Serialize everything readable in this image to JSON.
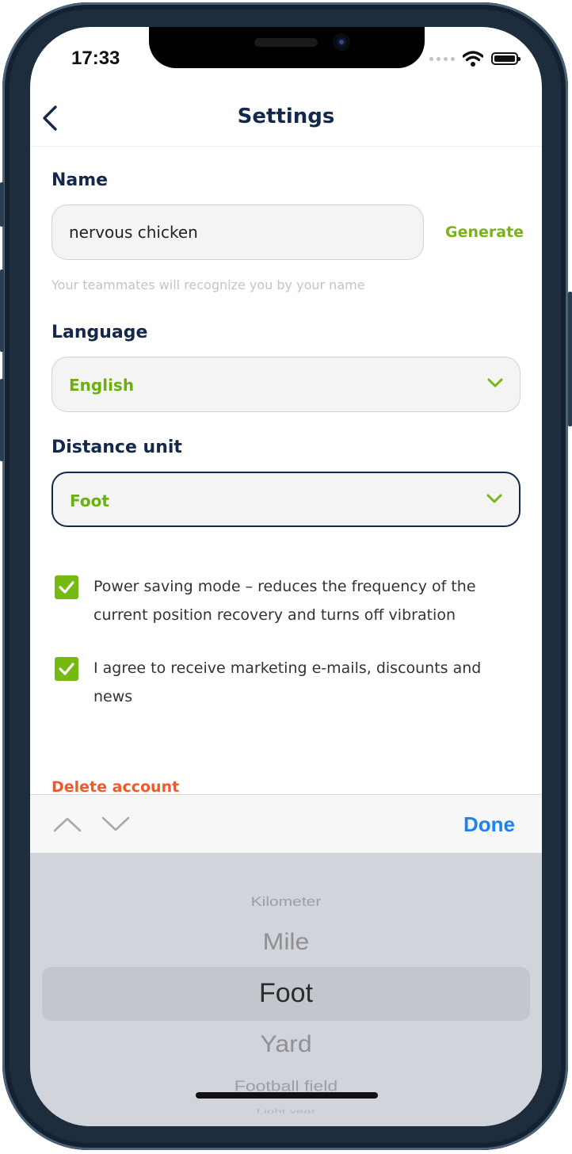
{
  "status_bar": {
    "time": "17:33"
  },
  "nav": {
    "title": "Settings"
  },
  "name_section": {
    "label": "Name",
    "value": "nervous chicken",
    "generate_label": "Generate",
    "hint": "Your teammates will recognize you by your name"
  },
  "language_section": {
    "label": "Language",
    "selected": "English"
  },
  "distance_section": {
    "label": "Distance unit",
    "selected": "Foot"
  },
  "checkboxes": [
    {
      "label": "Power saving mode – reduces the frequency of the current position recovery and turns off vibration",
      "checked": true
    },
    {
      "label": "I agree to receive marketing e-mails, discounts and news",
      "checked": true
    }
  ],
  "delete_account_label": "Delete account",
  "toolbar": {
    "done_label": "Done"
  },
  "picker": {
    "options": [
      "Kilometer",
      "Mile",
      "Foot",
      "Yard",
      "Football field",
      "Light year"
    ],
    "selected": "Foot"
  },
  "colors": {
    "navy": "#13294b",
    "accent_green": "#76b913",
    "danger": "#f1592a",
    "ios_blue": "#1a82f5"
  }
}
